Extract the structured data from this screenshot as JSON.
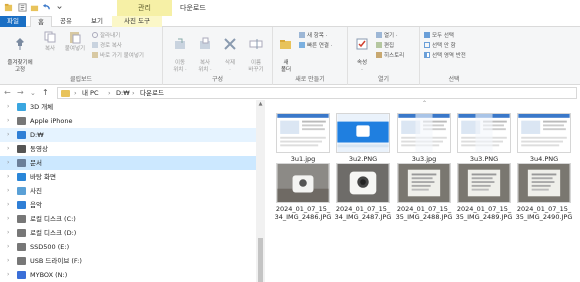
{
  "titlebar": {
    "manage_tab": "관리",
    "folder_name": "다운로드"
  },
  "tabs": {
    "file": "파일",
    "home": "홈",
    "share": "공유",
    "view": "보기",
    "picture_tools": "사진 도구"
  },
  "ribbon": {
    "clipboard": {
      "label": "클립보드",
      "pin": "즐겨찾기에\n고정",
      "copy": "복사",
      "paste": "붙여넣기",
      "cut": "잘라내기",
      "copy_path": "경로 복사",
      "paste_shortcut": "바로 가기 붙여넣기"
    },
    "organize": {
      "label": "구성",
      "move_to": "이동\n위치 ·",
      "copy_to": "복사\n위치 ·",
      "delete": "삭제\n·",
      "rename": "이름\n바꾸기"
    },
    "new": {
      "label": "새로 만들기",
      "new_folder": "새\n폴더",
      "new_item": "새 항목 ·",
      "easy_access": "빠른 연결 ·"
    },
    "open": {
      "label": "열기",
      "properties": "속성\n·",
      "open": "열기 ·",
      "edit": "편집",
      "history": "히스토리"
    },
    "select": {
      "label": "선택",
      "select_all": "모두 선택",
      "select_none": "선택 안 함",
      "invert": "선택 영역 반전"
    }
  },
  "address": {
    "back": "←",
    "forward": "→",
    "recent": "⌄",
    "up": "↑",
    "segments": [
      "›",
      "내 PC",
      "›",
      "D:₩",
      "›",
      "다운로드"
    ]
  },
  "nav": {
    "items": [
      {
        "label": "3D 개체",
        "icon": "cube-icon",
        "color": "#3aa6e0"
      },
      {
        "label": "Apple iPhone",
        "icon": "phone-icon",
        "color": "#777777"
      },
      {
        "label": "D:₩",
        "icon": "download-icon",
        "color": "#2f7fd6"
      },
      {
        "label": "동영상",
        "icon": "video-icon",
        "color": "#555555"
      },
      {
        "label": "문서",
        "icon": "document-icon",
        "color": "#6b7f99"
      },
      {
        "label": "바탕 화면",
        "icon": "desktop-icon",
        "color": "#2a86d8"
      },
      {
        "label": "사진",
        "icon": "picture-icon",
        "color": "#5aa0d6"
      },
      {
        "label": "음악",
        "icon": "music-icon",
        "color": "#2f7fd6"
      },
      {
        "label": "로컬 디스크 (C:)",
        "icon": "drive-icon",
        "color": "#777777"
      },
      {
        "label": "로컬 디스크 (D:)",
        "icon": "drive-icon",
        "color": "#777777"
      },
      {
        "label": "SSD500 (E:)",
        "icon": "drive-icon",
        "color": "#777777"
      },
      {
        "label": "USB 드라이브 (F:)",
        "icon": "usb-drive-icon",
        "color": "#777777"
      },
      {
        "label": "MYBOX (N:)",
        "icon": "cloud-drive-icon",
        "color": "#3b6fd8"
      }
    ]
  },
  "files": [
    {
      "name": "3u1.jpg"
    },
    {
      "name": "3u2.PNG"
    },
    {
      "name": "3u3.jpg"
    },
    {
      "name": "3u3.PNG"
    },
    {
      "name": "3u4.PNG"
    },
    {
      "name": "2024_01_07_15_34_IMG_2486.JPG"
    },
    {
      "name": "2024_01_07_15_34_IMG_2487.JPG"
    },
    {
      "name": "2024_01_07_15_35_IMG_2488.JPG"
    },
    {
      "name": "2024_01_07_15_35_IMG_2489.JPG"
    },
    {
      "name": "2024_01_07_15_35_IMG_2490.JPG"
    }
  ],
  "colors": {
    "accent": "#1a6fc4",
    "selection": "#cce8ff",
    "manage_tab": "#f6f0a6"
  }
}
